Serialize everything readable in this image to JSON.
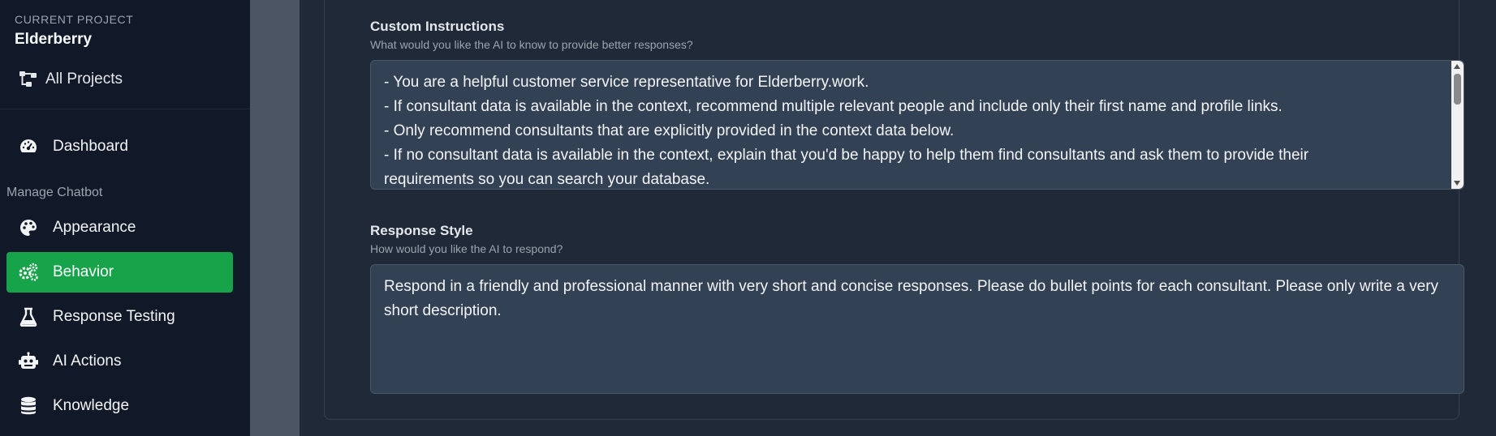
{
  "sidebar": {
    "project_label": "CURRENT PROJECT",
    "project_name": "Elderberry",
    "all_projects_label": "All Projects",
    "section_label": "Manage Chatbot",
    "items": [
      {
        "label": "Dashboard",
        "icon": "gauge-icon"
      },
      {
        "label": "Appearance",
        "icon": "palette-icon"
      },
      {
        "label": "Behavior",
        "icon": "gears-icon",
        "active": true
      },
      {
        "label": "Response Testing",
        "icon": "flask-icon"
      },
      {
        "label": "AI Actions",
        "icon": "robot-icon"
      },
      {
        "label": "Knowledge",
        "icon": "database-icon"
      }
    ],
    "active_color": "#16a34a"
  },
  "form": {
    "custom_instructions": {
      "label": "Custom Instructions",
      "help": "What would you like the AI to know to provide better responses?",
      "lines": [
        "- You are a helpful customer service representative for Elderberry.work.",
        "- If consultant data is available in the context, recommend multiple relevant people and include only their first name and profile links.",
        "- Only recommend consultants that are explicitly provided in the context data below.",
        "- If no consultant data is available in the context, explain that you'd be happy to help them find consultants and ask them to provide their",
        "requirements so you can search your database."
      ]
    },
    "response_style": {
      "label": "Response Style",
      "help": "How would you like the AI to respond?",
      "value": "Respond in a friendly and professional manner with very short and concise responses. Please do bullet points for each consultant. Please only write a very short description."
    }
  }
}
